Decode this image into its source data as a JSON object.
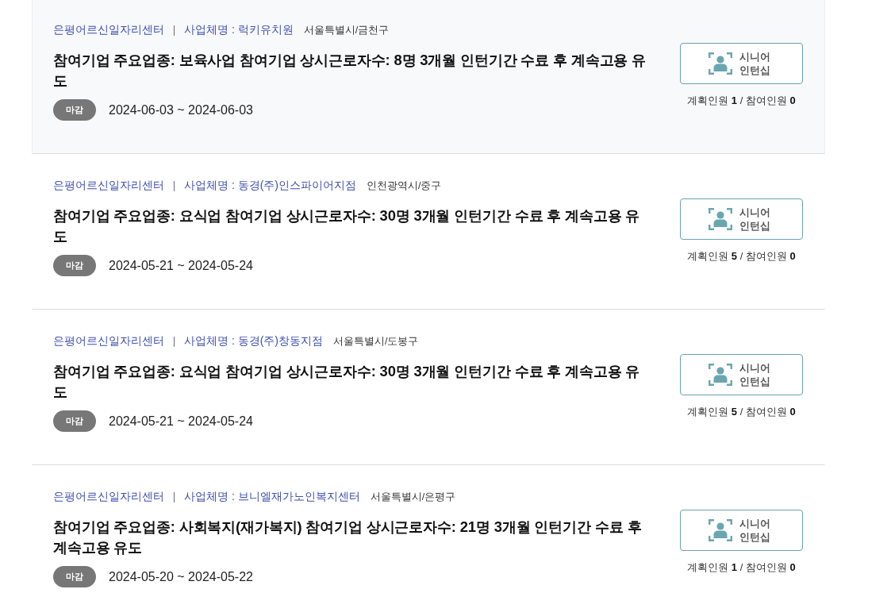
{
  "listings": [
    {
      "highlighted": true,
      "center": "은평어르신일자리센터",
      "company": "사업체명 : 럭키유치원",
      "region": "서울특별시/금천구",
      "title": "참여기업 주요업종: 보육사업 참여기업 상시근로자수: 8명 3개월 인턴기간 수료 후 계속고용 유도",
      "status": "마감",
      "period": "2024-06-03 ~ 2024-06-03",
      "program_button": "시니어 인턴십",
      "headcount": "계획인원 **1** / 참여인원 **0**"
    },
    {
      "highlighted": false,
      "center": "은평어르신일자리센터",
      "company": "사업체명 : 동경(주)인스파이어지점",
      "region": "인천광역시/중구",
      "title": "참여기업 주요업종: 요식업 참여기업 상시근로자수: 30명 3개월 인턴기간 수료 후 계속고용 유도",
      "status": "마감",
      "period": "2024-05-21 ~ 2024-05-24",
      "program_button": "시니어 인턴십",
      "headcount": "계획인원 **5** / 참여인원 **0**"
    },
    {
      "highlighted": false,
      "center": "은평어르신일자리센터",
      "company": "사업체명 : 동경(주)창동지점",
      "region": "서울특별시/도봉구",
      "title": "참여기업 주요업종: 요식업 참여기업 상시근로자수: 30명 3개월 인턴기간 수료 후 계속고용 유도",
      "status": "마감",
      "period": "2024-05-21 ~ 2024-05-24",
      "program_button": "시니어 인턴십",
      "headcount": "계획인원 **5** / 참여인원 **0**"
    },
    {
      "highlighted": false,
      "center": "은평어르신일자리센터",
      "company": "사업체명 : 브니엘재가노인복지센터",
      "region": "서울특별시/은평구",
      "title": "참여기업 주요업종: 사회복지(재가복지) 참여기업 상시근로자수: 21명 3개월 인턴기간 수료 후 계속고용 유도",
      "status": "마감",
      "period": "2024-05-20 ~ 2024-05-22",
      "program_button": "시니어 인턴십",
      "headcount": "계획인원 **1** / 참여인원 **0**"
    }
  ]
}
